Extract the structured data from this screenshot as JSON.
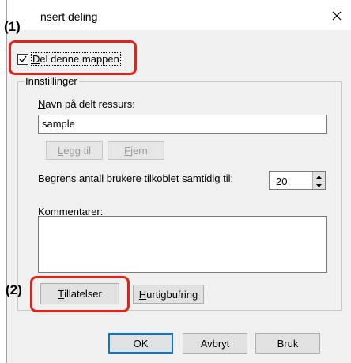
{
  "dialog": {
    "title": "nsert deling",
    "close_icon": "close-icon"
  },
  "callouts": {
    "one": "(1)",
    "two": "(2)"
  },
  "share_checkbox": {
    "checked": true,
    "label_prefix": "D",
    "label_rest": "el denne mappen"
  },
  "settings": {
    "group_label": "Innstillinger",
    "share_name_label_prefix": "N",
    "share_name_label_rest": "avn på delt ressurs:",
    "share_name_value": "sample",
    "add_button_prefix": "L",
    "add_button_rest": "egg til",
    "remove_button_prefix": "F",
    "remove_button_rest": "jern",
    "user_limit_label_prefix": "B",
    "user_limit_label_rest": "egrens antall brukere tilkoblet samtidig til:",
    "user_limit_value": "20",
    "comments_label_prefix": "K",
    "comments_label_rest": "ommentarer:",
    "comments_value": "",
    "permissions_button_prefix": "T",
    "permissions_button_rest": "illatelser",
    "caching_button_prefix": "H",
    "caching_button_rest": "urtigbufring"
  },
  "footer": {
    "ok_label": "OK",
    "cancel_label": "Avbryt",
    "apply_label": "Bruk"
  },
  "colors": {
    "highlight": "#e2231a",
    "focus": "#0078d7"
  }
}
